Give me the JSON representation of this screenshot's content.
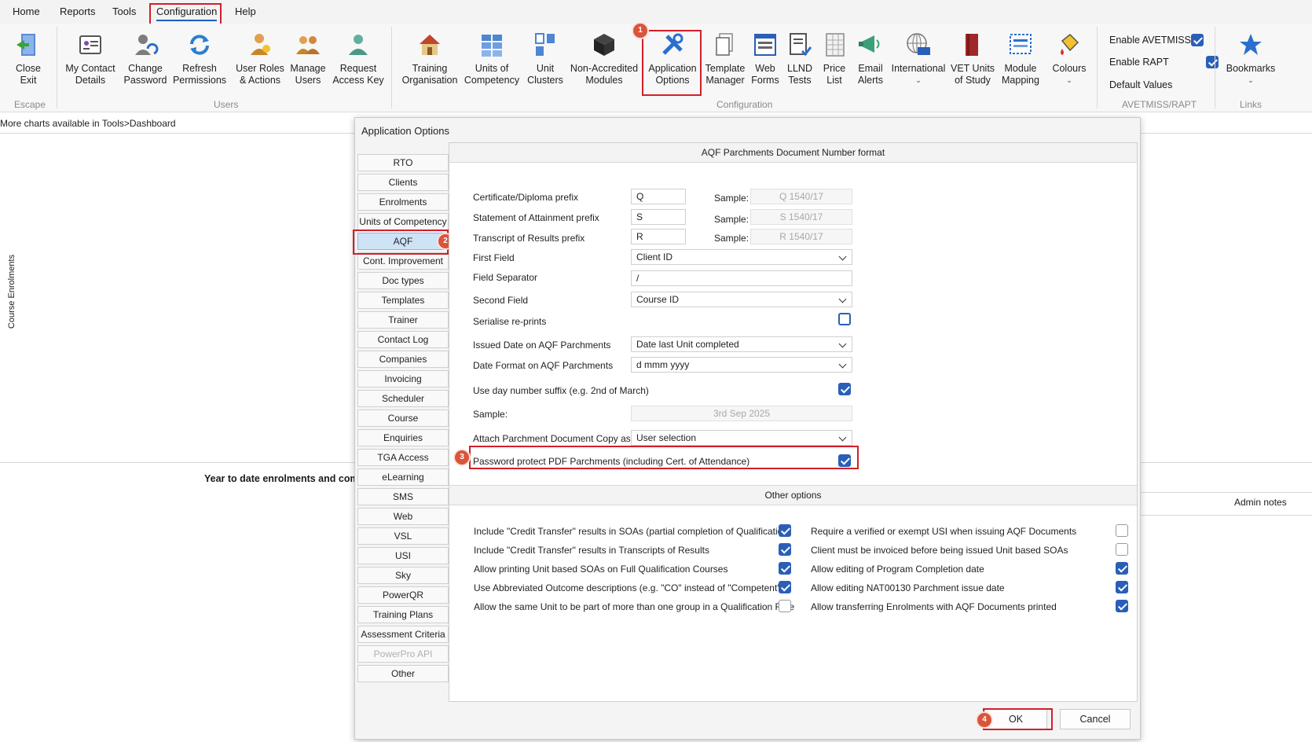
{
  "menu": {
    "home": "Home",
    "reports": "Reports",
    "tools": "Tools",
    "configuration": "Configuration",
    "help": "Help"
  },
  "ribbon": {
    "escape": {
      "close_exit": "Close\nExit",
      "group": "Escape"
    },
    "users": {
      "my_contact": "My Contact\nDetails",
      "change_password": "Change\nPassword",
      "refresh_permissions": "Refresh\nPermissions",
      "user_roles": "User Roles\n& Actions",
      "manage_users": "Manage\nUsers",
      "request_access": "Request\nAccess Key",
      "group": "Users"
    },
    "configuration": {
      "training_org": "Training\nOrganisation",
      "units": "Units of\nCompetency",
      "unit_clusters": "Unit\nClusters",
      "non_accredited": "Non-Accredited\nModules",
      "app_options": "Application\nOptions",
      "template_manager": "Template\nManager",
      "web_forms": "Web\nForms",
      "llnd_tests": "LLND\nTests",
      "price_list": "Price\nList",
      "email_alerts": "Email\nAlerts",
      "international": "International",
      "vet_units": "VET Units\nof Study",
      "module_mapping": "Module\nMapping",
      "colours": "Colours",
      "group": "Configuration"
    },
    "avetmiss": {
      "enable_avetmiss": "Enable AVETMISS",
      "enable_rapt": "Enable RAPT",
      "default_values": "Default Values",
      "group": "AVETMISS/RAPT"
    },
    "links": {
      "bookmarks": "Bookmarks",
      "group": "Links"
    }
  },
  "background": {
    "info_text": "More charts available in Tools>Dashboard",
    "axis_label": "Course Enrolments",
    "ytd_text": "Year to date enrolments and comp",
    "admin_notes": "Admin notes"
  },
  "dialog": {
    "title": "Application Options",
    "nav": [
      "RTO",
      "Clients",
      "Enrolments",
      "Units of Competency",
      "AQF",
      "Cont. Improvement",
      "Doc types",
      "Templates",
      "Trainer",
      "Contact Log",
      "Companies",
      "Invoicing",
      "Scheduler",
      "Course",
      "Enquiries",
      "TGA Access",
      "eLearning",
      "SMS",
      "Web",
      "VSL",
      "USI",
      "Sky",
      "PowerQR",
      "Training Plans",
      "Assessment Criteria",
      "PowerPro API",
      "Other"
    ],
    "aqf_header": "AQF Parchments Document Number format",
    "fields": {
      "cert_prefix_label": "Certificate/Diploma prefix",
      "cert_prefix": "Q",
      "cert_sample": "Q 1540/17",
      "soa_prefix_label": "Statement of Attainment prefix",
      "soa_prefix": "S",
      "soa_sample": "S 1540/17",
      "tor_prefix_label": "Transcript of Results prefix",
      "tor_prefix": "R",
      "tor_sample": "R 1540/17",
      "sample_label": "Sample:",
      "first_field_label": "First Field",
      "first_field": "Client ID",
      "separator_label": "Field Separator",
      "separator": "/",
      "second_field_label": "Second Field",
      "second_field": "Course ID",
      "serialise_label": "Serialise re-prints",
      "issued_date_label": "Issued Date on AQF Parchments",
      "issued_date": "Date last Unit completed",
      "date_format_label": "Date Format on AQF Parchments",
      "date_format": "d mmm yyyy",
      "day_suffix_label": "Use day number suffix (e.g. 2nd of March)",
      "sample2_label": "Sample:",
      "sample2": "3rd Sep 2025",
      "attach_label": "Attach Parchment Document Copy as",
      "attach": "User selection",
      "password_label": "Password protect PDF Parchments (including Cert. of Attendance)"
    },
    "other_header": "Other options",
    "other_left": [
      {
        "label": "Include \"Credit Transfer\" results in SOAs (partial completion of Qualification)",
        "checked": true
      },
      {
        "label": "Include \"Credit Transfer\" results in Transcripts of Results",
        "checked": true
      },
      {
        "label": "Allow printing Unit based SOAs on Full Qualification Courses",
        "checked": true
      },
      {
        "label": "Use Abbreviated Outcome descriptions (e.g. \"CO\" instead of \"Competent\")",
        "checked": true
      },
      {
        "label": "Allow the same Unit to be part of more than one group in a Qualification Rule",
        "checked": false
      }
    ],
    "other_right": [
      {
        "label": "Require a verified or exempt USI when issuing AQF Documents",
        "checked": false
      },
      {
        "label": "Client must be invoiced before being issued Unit based SOAs",
        "checked": false
      },
      {
        "label": "Allow editing of Program Completion date",
        "checked": true
      },
      {
        "label": "Allow editing NAT00130 Parchment issue date",
        "checked": true
      },
      {
        "label": "Allow transferring Enrolments with AQF Documents printed",
        "checked": true
      }
    ],
    "ok": "OK",
    "cancel": "Cancel"
  },
  "badges": [
    "1",
    "2",
    "3",
    "4"
  ],
  "colors": {
    "accent": "#2a5fb8",
    "highlight": "#d21f2b",
    "badge": "#d9553a",
    "nav_active": "#cfe3f7"
  }
}
